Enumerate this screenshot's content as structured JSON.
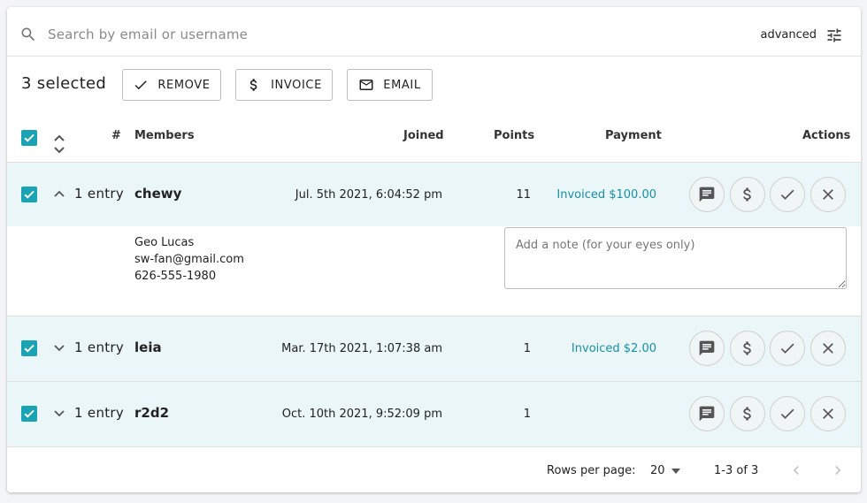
{
  "search": {
    "placeholder": "Search by email or username",
    "advanced_label": "advanced"
  },
  "toolbar": {
    "selected_text": "3 selected",
    "remove_label": "REMOVE",
    "invoice_label": "INVOICE",
    "email_label": "EMAIL"
  },
  "table": {
    "headers": {
      "num": "#",
      "members": "Members",
      "joined": "Joined",
      "points": "Points",
      "payment": "Payment",
      "actions": "Actions"
    },
    "rows": [
      {
        "entry": "1 entry",
        "member": "chewy",
        "joined": "Jul. 5th 2021, 6:04:52 pm",
        "points": "11",
        "payment": "Invoiced $100.00",
        "selected": true,
        "expanded": true
      },
      {
        "entry": "1 entry",
        "member": "leia",
        "joined": "Mar. 17th 2021, 1:07:38 am",
        "points": "1",
        "payment": "Invoiced $2.00",
        "selected": true,
        "expanded": false
      },
      {
        "entry": "1 entry",
        "member": "r2d2",
        "joined": "Oct. 10th 2021, 9:52:09 pm",
        "points": "1",
        "payment": "",
        "selected": true,
        "expanded": false
      }
    ],
    "expanded_detail": {
      "full_name": "Geo Lucas",
      "email": "sw-fan@gmail.com",
      "phone": "626-555-1980",
      "note_placeholder": "Add a note (for your eyes only)"
    }
  },
  "footer": {
    "rows_per_page_label": "Rows per page:",
    "rows_per_page_value": "20",
    "range": "1-3 of 3"
  },
  "colors": {
    "accent": "#1aa3b4",
    "payment_text": "#178fa6",
    "selected_row_bg": "#eaf6f8"
  },
  "icons": [
    "search-icon",
    "tune-icon",
    "check-icon",
    "dollar-icon",
    "mail-icon",
    "sort-icon",
    "chevron-up-icon",
    "chevron-down-icon",
    "comment-icon",
    "close-icon",
    "prev-page-icon",
    "next-page-icon"
  ]
}
